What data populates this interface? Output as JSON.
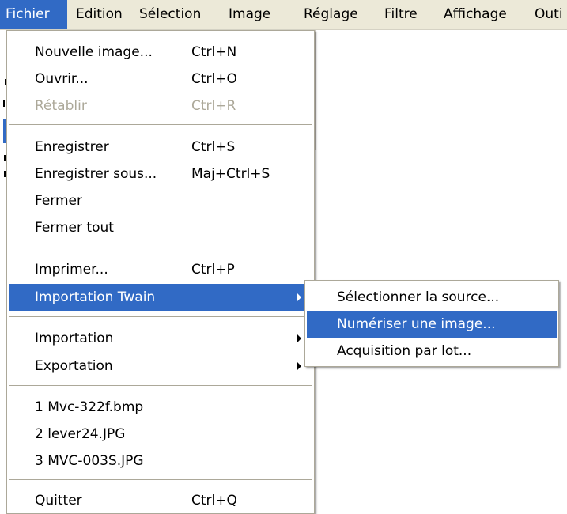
{
  "menubar": {
    "items": [
      {
        "label": "Fichier",
        "active": true
      },
      {
        "label": "Edition",
        "active": false
      },
      {
        "label": "Sélection",
        "active": false
      },
      {
        "label": "Image",
        "active": false
      },
      {
        "label": "Réglage",
        "active": false
      },
      {
        "label": "Filtre",
        "active": false
      },
      {
        "label": "Affichage",
        "active": false
      },
      {
        "label": "Outi",
        "active": false
      }
    ]
  },
  "file_menu": {
    "items": [
      {
        "label": "Nouvelle image...",
        "shortcut": "Ctrl+N"
      },
      {
        "label": "Ouvrir...",
        "shortcut": "Ctrl+O"
      },
      {
        "label": "Rétablir",
        "shortcut": "Ctrl+R",
        "disabled": true
      },
      {
        "label": "Enregistrer",
        "shortcut": "Ctrl+S"
      },
      {
        "label": "Enregistrer sous...",
        "shortcut": "Maj+Ctrl+S"
      },
      {
        "label": "Fermer",
        "shortcut": ""
      },
      {
        "label": "Fermer tout",
        "shortcut": ""
      },
      {
        "label": "Imprimer...",
        "shortcut": "Ctrl+P"
      },
      {
        "label": "Importation Twain",
        "shortcut": "",
        "submenu": true,
        "highlighted": true
      },
      {
        "label": "Importation",
        "shortcut": "",
        "submenu": true
      },
      {
        "label": "Exportation",
        "shortcut": "",
        "submenu": true
      },
      {
        "label": "1 Mvc-322f.bmp",
        "shortcut": ""
      },
      {
        "label": "2 lever24.JPG",
        "shortcut": ""
      },
      {
        "label": "3 MVC-003S.JPG",
        "shortcut": ""
      },
      {
        "label": "Quitter",
        "shortcut": "Ctrl+Q"
      }
    ]
  },
  "twain_submenu": {
    "items": [
      {
        "label": "Sélectionner la source..."
      },
      {
        "label": "Numériser une image...",
        "highlighted": true
      },
      {
        "label": "Acquisition par lot..."
      }
    ]
  },
  "colors": {
    "highlight": "#316ac5",
    "menubar_bg": "#ece9d8",
    "disabled_text": "#aca899"
  }
}
